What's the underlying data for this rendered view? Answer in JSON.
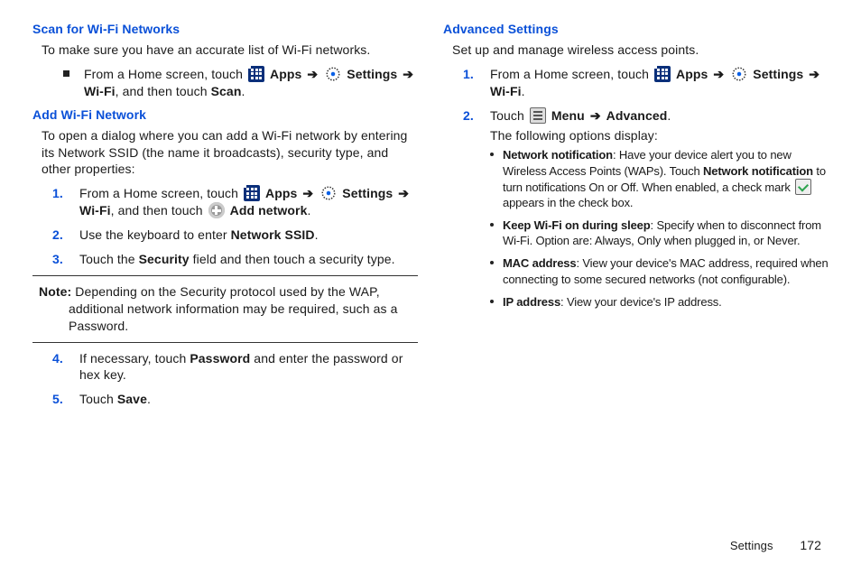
{
  "left": {
    "scan": {
      "heading": "Scan for Wi-Fi Networks",
      "intro": "To make sure you have an accurate list of Wi-Fi networks.",
      "item_a": "From a Home screen, touch ",
      "apps": "Apps",
      "settings": "Settings",
      "wifi": "Wi-Fi",
      "tail": ", and then touch ",
      "scan": "Scan"
    },
    "add": {
      "heading": "Add Wi-Fi Network",
      "intro": "To open a dialog where you can add a Wi-Fi network by entering its Network SSID (the name it broadcasts), security type, and other properties:",
      "step1_a": "From a Home screen, touch ",
      "apps": "Apps",
      "settings": "Settings",
      "wifi": "Wi-Fi",
      "mid": ", and then touch ",
      "addnet": "Add network",
      "step2_a": "Use the keyboard to enter ",
      "step2_b": "Network SSID",
      "step3_a": "Touch the ",
      "step3_b": "Security",
      "step3_c": " field and then touch a security type.",
      "note_label": "Note:",
      "note_body": " Depending on the Security protocol used by the WAP, additional network information may be required, such as a Password.",
      "step4_a": "If necessary, touch ",
      "step4_b": "Password",
      "step4_c": " and enter the password or hex key.",
      "step5_a": "Touch ",
      "step5_b": "Save"
    }
  },
  "right": {
    "adv": {
      "heading": "Advanced Settings",
      "intro": "Set up and manage wireless access points.",
      "step1_a": "From a Home screen, touch ",
      "apps": "Apps",
      "settings": "Settings",
      "wifi": "Wi-Fi",
      "step2_a": "Touch ",
      "menu": "Menu",
      "advanced": "Advanced",
      "step2_tail": "The following options display:",
      "b1_title": "Network notification",
      "b1_body_a": ": Have your device alert you to new Wireless Access Points (WAPs). Touch ",
      "b1_body_b": "Network notification",
      "b1_body_c": " to turn notifications On or Off. When enabled, a check mark ",
      "b1_body_d": " appears in the check box.",
      "b2_title": "Keep Wi-Fi on during sleep",
      "b2_body": ": Specify when to disconnect from Wi-Fi. Option are: Always, Only when plugged in, or Never.",
      "b3_title": "MAC address",
      "b3_body": ": View your device's MAC address, required when connecting to some secured networks (not configurable).",
      "b4_title": "IP address",
      "b4_body": ": View your device's IP address."
    }
  },
  "footer": {
    "section": "Settings",
    "page": "172"
  }
}
